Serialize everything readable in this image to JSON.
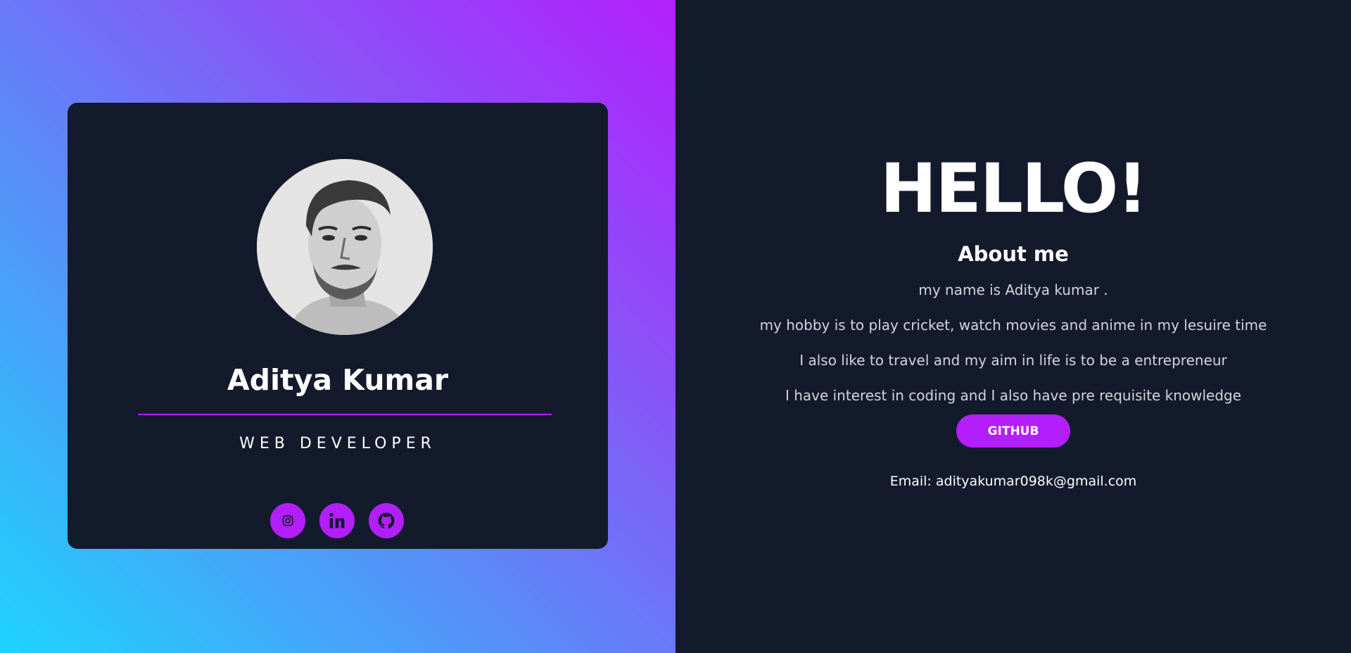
{
  "profile": {
    "name": "Aditya Kumar",
    "role": "WEB DEVELOPER",
    "avatar_icon": "profile-photo",
    "social": [
      {
        "icon": "instagram-icon"
      },
      {
        "icon": "linkedin-icon"
      },
      {
        "icon": "github-icon"
      }
    ]
  },
  "about": {
    "greeting": "HELLO!",
    "title": "About me",
    "lines": [
      "my name is Aditya kumar .",
      "my hobby is to play cricket, watch movies and anime in my lesuire time",
      "I also like to travel and my aim in life is to be a entrepreneur",
      "I have interest in coding and I also have pre requisite knowledge"
    ],
    "github_button": "GITHUB",
    "email_text": "Email: adityakumar098k@gmail.com"
  },
  "colors": {
    "accent": "#b31ffc",
    "dark_bg": "#131a2c",
    "gradient_start": "#1ed4fd",
    "gradient_end": "#b31ffc"
  }
}
